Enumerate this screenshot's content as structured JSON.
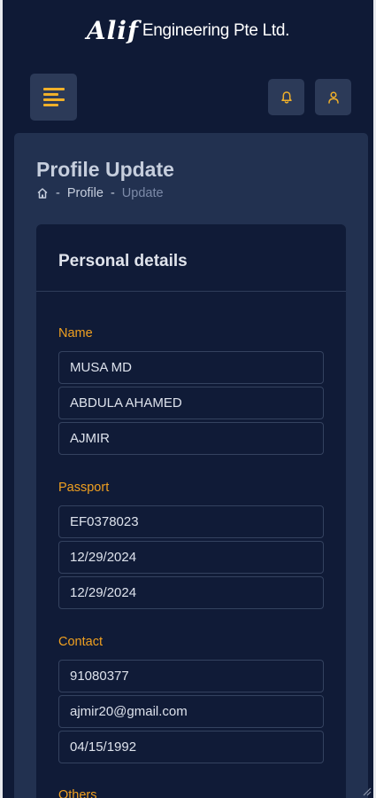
{
  "logo": {
    "brand": "Alif",
    "company": "Engineering Pte Ltd."
  },
  "icons": {
    "menu": "menu-icon",
    "bell": "bell-icon",
    "user": "user-icon",
    "home": "home-icon"
  },
  "colors": {
    "background": "#0f1a36",
    "panel": "#223150",
    "card": "#101b37",
    "accent": "#f0a020"
  },
  "page": {
    "title": "Profile Update",
    "breadcrumb": {
      "separator": "-",
      "profile": "Profile",
      "current": "Update"
    }
  },
  "card": {
    "title": "Personal details",
    "groups": {
      "name": {
        "label": "Name",
        "fields": [
          "MUSA MD",
          "ABDULA AHAMED",
          "AJMIR"
        ]
      },
      "passport": {
        "label": "Passport",
        "fields": [
          "EF0378023",
          "12/29/2024",
          "12/29/2024"
        ]
      },
      "contact": {
        "label": "Contact",
        "fields": [
          "91080377",
          "ajmir20@gmail.com",
          "04/15/1992"
        ]
      },
      "others": {
        "label": "Others"
      }
    }
  }
}
